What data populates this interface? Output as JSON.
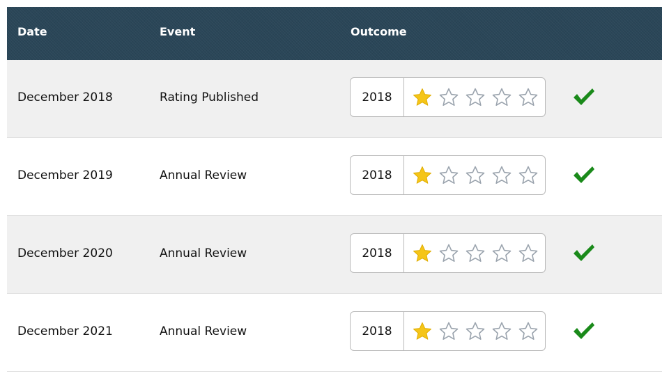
{
  "columns": {
    "date": "Date",
    "event": "Event",
    "outcome": "Outcome"
  },
  "rows": [
    {
      "date": "December 2018",
      "event": "Rating Published",
      "year": "2018",
      "stars_filled": 1,
      "stars_total": 5,
      "status_icon": "checkmark-icon"
    },
    {
      "date": "December 2019",
      "event": "Annual Review",
      "year": "2018",
      "stars_filled": 1,
      "stars_total": 5,
      "status_icon": "checkmark-icon"
    },
    {
      "date": "December 2020",
      "event": "Annual Review",
      "year": "2018",
      "stars_filled": 1,
      "stars_total": 5,
      "status_icon": "checkmark-icon"
    },
    {
      "date": "December 2021",
      "event": "Annual Review",
      "year": "2018",
      "stars_filled": 1,
      "stars_total": 5,
      "status_icon": "checkmark-icon"
    }
  ],
  "colors": {
    "header_bg": "#2a4658",
    "star_filled": "#f5c518",
    "star_empty": "#9aa3ad",
    "check": "#1a8a1a",
    "row_shade": "#f0f0f0"
  }
}
